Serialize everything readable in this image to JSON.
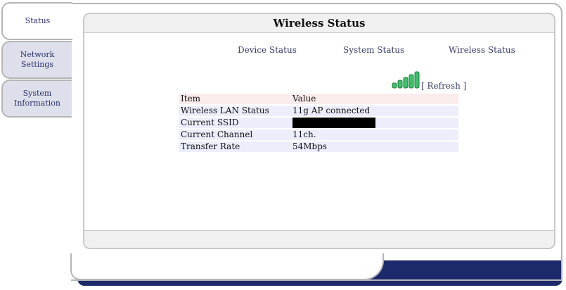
{
  "sidebar": {
    "tabs": [
      {
        "label": "Status",
        "active": true
      },
      {
        "label": "Network Settings",
        "active": false
      },
      {
        "label": "System Information",
        "active": false
      }
    ]
  },
  "panel": {
    "title": "Wireless Status",
    "subnav": [
      "Device Status",
      "System Status",
      "Wireless Status"
    ],
    "refresh_label": "[ Refresh ]",
    "signal_bars_lit": 5,
    "signal_bars_total": 5
  },
  "table": {
    "headers": [
      "Item",
      "Value"
    ],
    "rows": [
      {
        "item": "Wireless LAN Status",
        "value": "11g AP connected"
      },
      {
        "item": "Current SSID",
        "value": ""
      },
      {
        "item": "Current Channel",
        "value": "11ch."
      },
      {
        "item": "Transfer Rate",
        "value": "54Mbps"
      }
    ]
  },
  "colors": {
    "navy": "#1c2a6b",
    "signal_green": "#3ec16a",
    "header_row": "#fbecec",
    "data_row": "#eceefc"
  }
}
